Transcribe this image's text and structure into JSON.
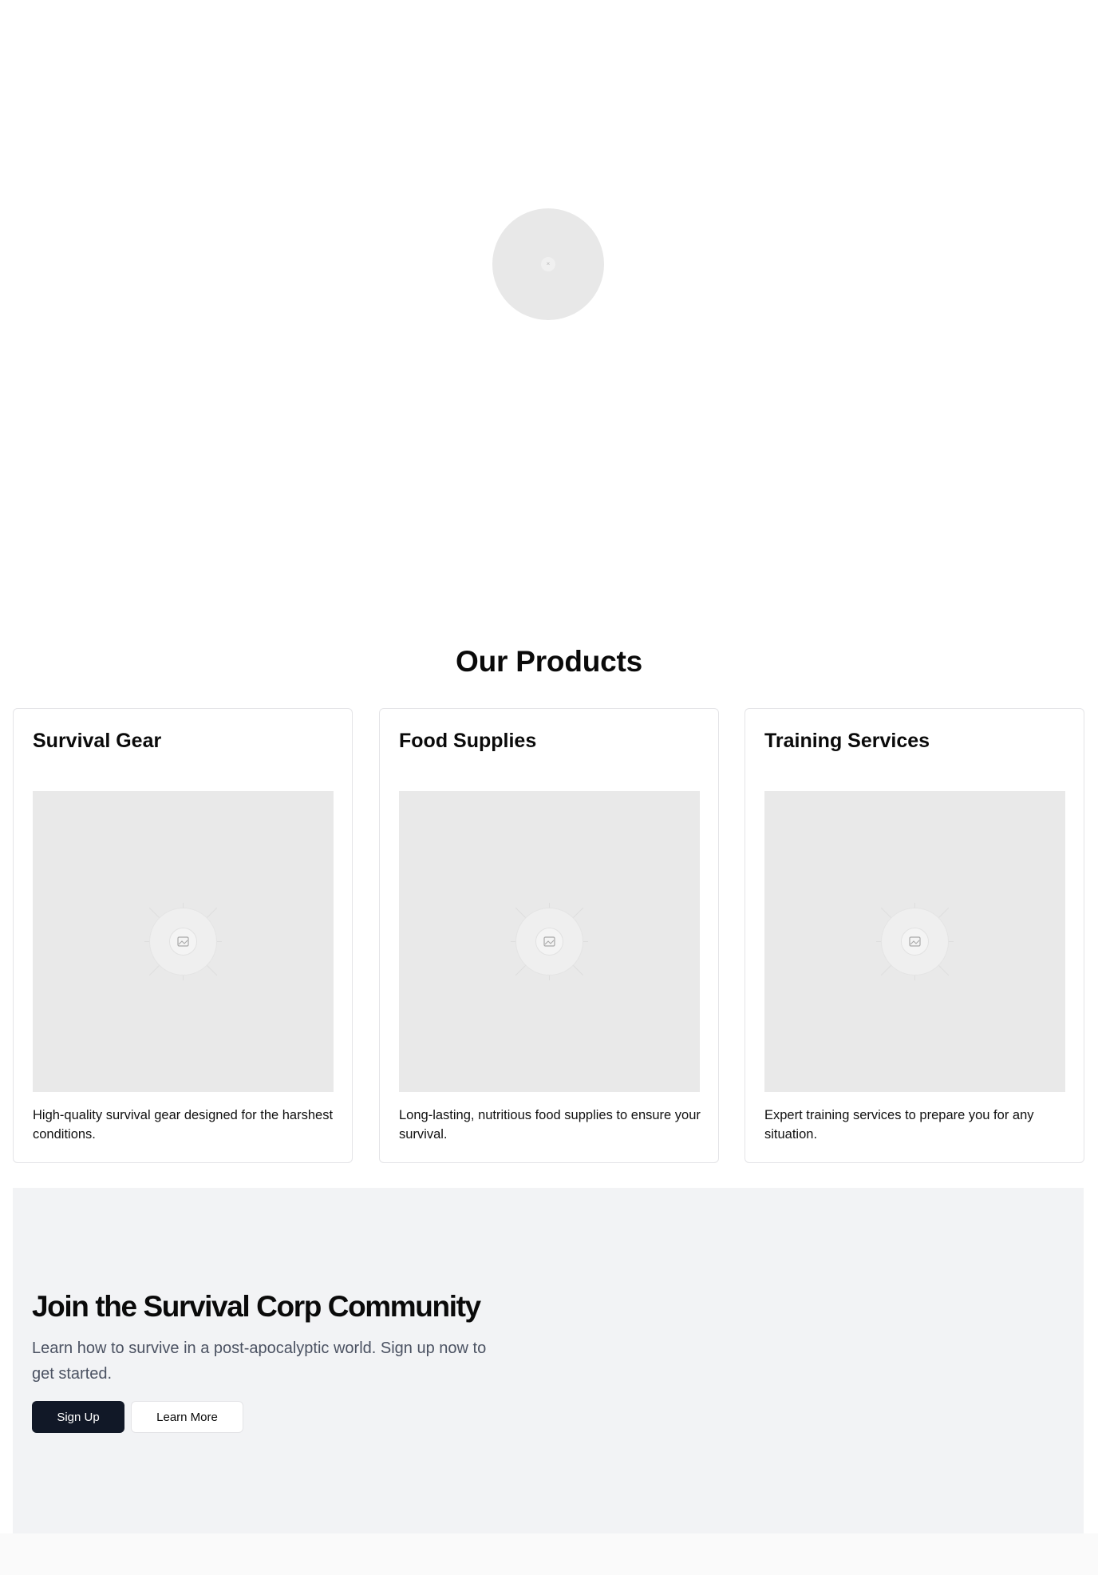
{
  "hero": {
    "image_icon": "image-placeholder-icon",
    "placeholder_glyph": "×"
  },
  "products": {
    "title": "Our Products",
    "items": [
      {
        "title": "Survival Gear",
        "description": "High-quality survival gear designed for the harshest conditions.",
        "image_icon": "image-placeholder-icon"
      },
      {
        "title": "Food Supplies",
        "description": "Long-lasting, nutritious food supplies to ensure your survival.",
        "image_icon": "image-placeholder-icon"
      },
      {
        "title": "Training Services",
        "description": "Expert training services to prepare you for any situation.",
        "image_icon": "image-placeholder-icon"
      }
    ]
  },
  "cta": {
    "title": "Join the Survival Corp Community",
    "text": "Learn how to survive in a post-apocalyptic world. Sign up now to get started.",
    "primary_button": "Sign Up",
    "secondary_button": "Learn More"
  },
  "colors": {
    "primary_button_bg": "#111827",
    "cta_background": "#f2f3f5",
    "placeholder_gray": "#e9e9e9"
  }
}
